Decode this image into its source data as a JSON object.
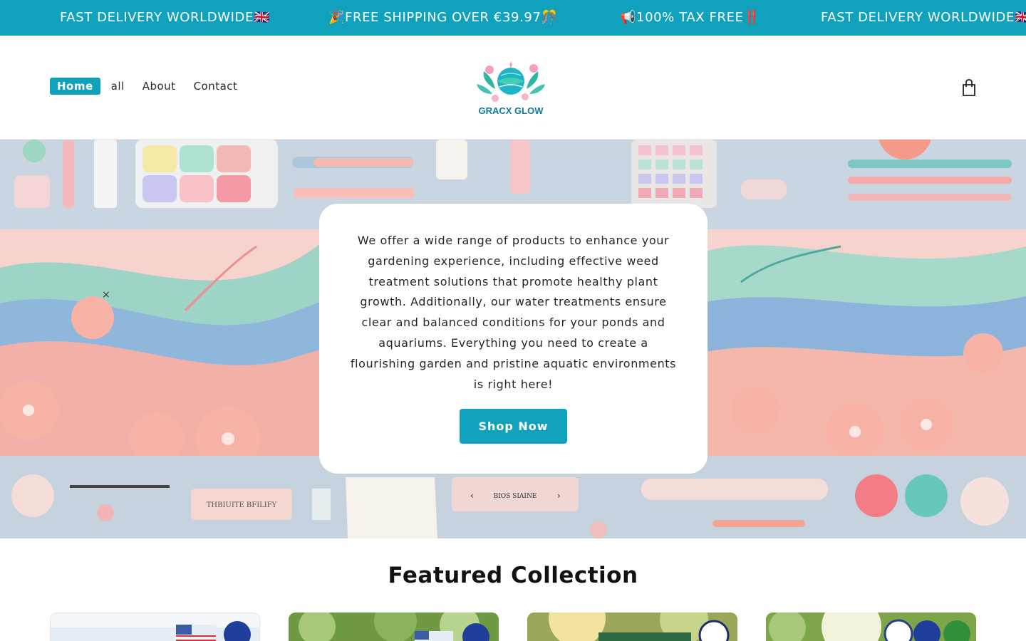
{
  "announcement": {
    "items": [
      "FAST DELIVERY WORLDWIDE🇬🇧",
      "🎉FREE SHIPPING OVER €39.97🎊",
      "📢100% TAX FREE‼️",
      "FAST DELIVERY WORLDWIDE🇬🇧"
    ]
  },
  "nav": {
    "items": [
      {
        "label": "Home",
        "active": true
      },
      {
        "label": "all"
      },
      {
        "label": "About"
      },
      {
        "label": "Contact"
      }
    ]
  },
  "logo": {
    "text": "GRACX GLOW"
  },
  "hero": {
    "close_glyph": "×",
    "text": "We offer a wide range of products to enhance your gardening experience, including effective weed treatment solutions that promote healthy plant growth. Additionally, our water treatments ensure clear and balanced conditions for your ponds and aquariums. Everything you need to create a flourishing garden and pristine aquatic environments is right here!",
    "cta": "Shop Now",
    "tray_label": "THBIUITE BFILIFY",
    "carousel_label": "BIOS SIAINE"
  },
  "featured": {
    "title": "Featured Collection"
  },
  "colors": {
    "accent": "#10a2bd",
    "hero_bg": "#cfdbe6"
  }
}
